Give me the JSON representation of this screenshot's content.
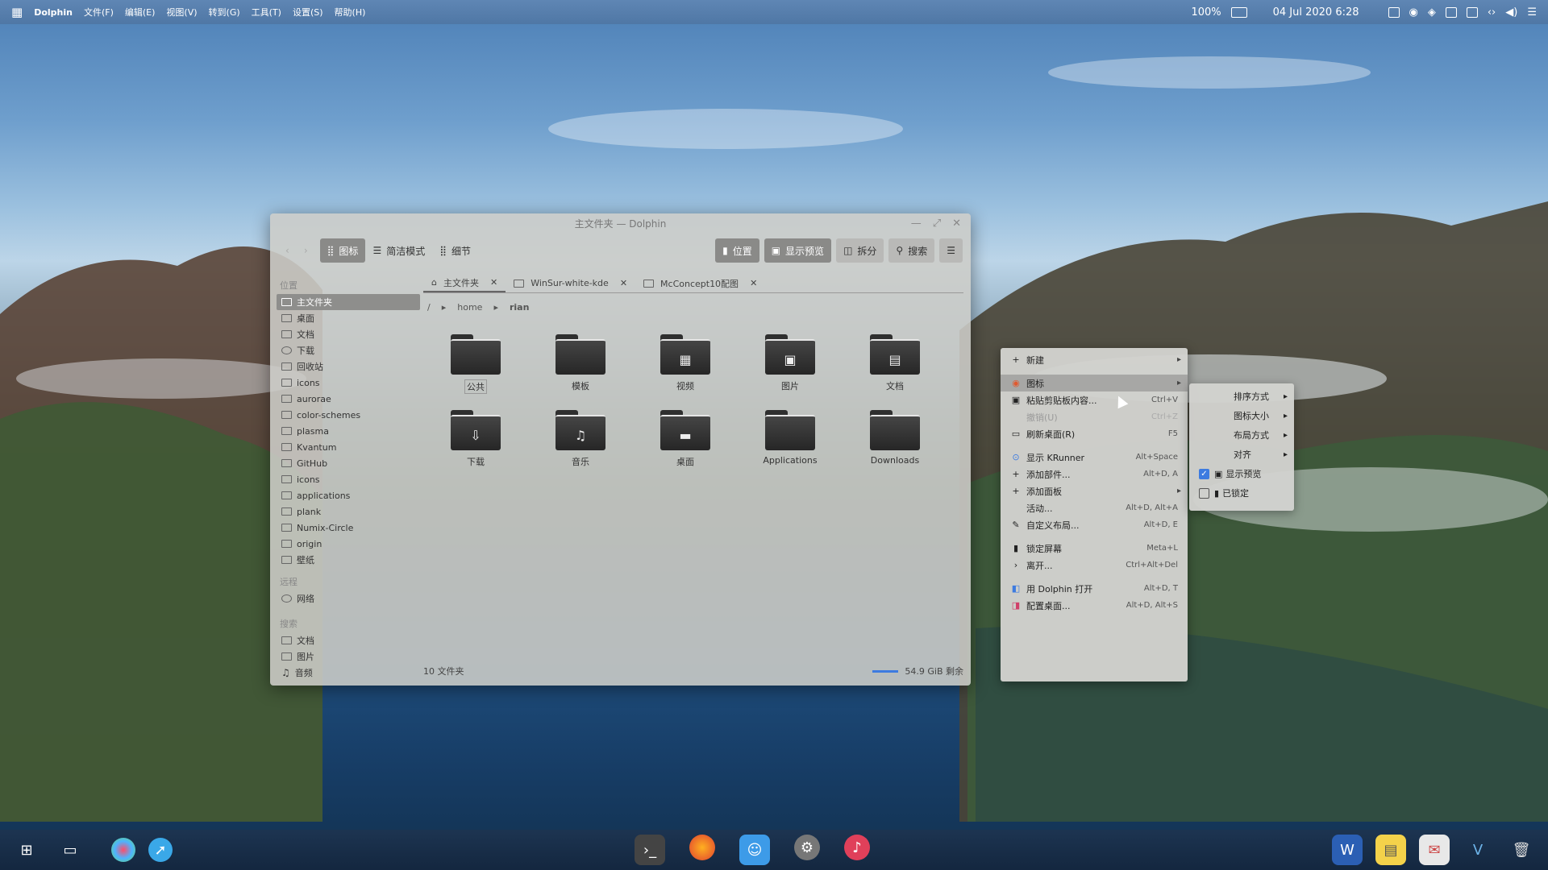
{
  "topbar": {
    "app": "Dolphin",
    "menus": [
      "文件(F)",
      "编辑(E)",
      "视图(V)",
      "转到(G)",
      "工具(T)",
      "设置(S)",
      "帮助(H)"
    ],
    "battery": "100%",
    "datetime": "04 Jul 2020 6:28"
  },
  "window": {
    "title": "主文件夹 — Dolphin",
    "toolbar": {
      "view_icons": "图标",
      "view_compact": "简洁模式",
      "view_details": "细节",
      "places": "位置",
      "preview": "显示预览",
      "split": "拆分",
      "search": "搜索"
    },
    "sidebar": {
      "places_header": "位置",
      "places": [
        "主文件夹",
        "桌面",
        "文档",
        "下载",
        "回收站",
        "icons",
        "aurorae",
        "color-schemes",
        "plasma",
        "Kvantum",
        "GitHub",
        "icons",
        "applications",
        "plank",
        "Numix-Circle",
        "origin",
        "壁纸"
      ],
      "remote_header": "远程",
      "remote": [
        "网络"
      ],
      "search_header": "搜索",
      "search": [
        "文档",
        "图片",
        "音频"
      ]
    },
    "tabs": [
      "主文件夹",
      "WinSur-white-kde",
      "McConcept10配图"
    ],
    "breadcrumb": [
      "/",
      "home",
      "rian"
    ],
    "files": [
      {
        "name": "公共",
        "glyph": ""
      },
      {
        "name": "模板",
        "glyph": ""
      },
      {
        "name": "视频",
        "glyph": "▦"
      },
      {
        "name": "图片",
        "glyph": "▣"
      },
      {
        "name": "文档",
        "glyph": "▤"
      },
      {
        "name": "下载",
        "glyph": "⇩"
      },
      {
        "name": "音乐",
        "glyph": "♫"
      },
      {
        "name": "桌面",
        "glyph": "▬"
      },
      {
        "name": "Applications",
        "glyph": ""
      },
      {
        "name": "Downloads",
        "glyph": ""
      }
    ],
    "status": {
      "count": "10 文件夹",
      "free": "54.9 GiB 剩余"
    }
  },
  "context_menu": {
    "items": [
      {
        "label": "新建",
        "shortcut": "",
        "arrow": "▸",
        "icon": "+",
        "state": ""
      },
      {
        "label": "图标",
        "shortcut": "",
        "arrow": "▸",
        "icon": "◉",
        "state": "hl"
      },
      {
        "label": "粘贴剪贴板内容...",
        "shortcut": "Ctrl+V",
        "arrow": "",
        "icon": "▣",
        "state": ""
      },
      {
        "label": "撤销(U)",
        "shortcut": "Ctrl+Z",
        "arrow": "",
        "icon": "",
        "state": "dis"
      },
      {
        "label": "刷新桌面(R)",
        "shortcut": "F5",
        "arrow": "",
        "icon": "▭",
        "state": ""
      },
      {
        "label": "显示 KRunner",
        "shortcut": "Alt+Space",
        "arrow": "",
        "icon": "⊙",
        "state": ""
      },
      {
        "label": "添加部件...",
        "shortcut": "Alt+D, A",
        "arrow": "",
        "icon": "+",
        "state": ""
      },
      {
        "label": "添加面板",
        "shortcut": "",
        "arrow": "▸",
        "icon": "+",
        "state": ""
      },
      {
        "label": "活动...",
        "shortcut": "Alt+D, Alt+A",
        "arrow": "",
        "icon": "",
        "state": ""
      },
      {
        "label": "自定义布局...",
        "shortcut": "Alt+D, E",
        "arrow": "",
        "icon": "✎",
        "state": ""
      },
      {
        "label": "锁定屏幕",
        "shortcut": "Meta+L",
        "arrow": "",
        "icon": "▮",
        "state": ""
      },
      {
        "label": "离开...",
        "shortcut": "Ctrl+Alt+Del",
        "arrow": "",
        "icon": "›",
        "state": ""
      },
      {
        "label": "用 Dolphin 打开",
        "shortcut": "Alt+D, T",
        "arrow": "",
        "icon": "◧",
        "state": ""
      },
      {
        "label": "配置桌面...",
        "shortcut": "Alt+D, Alt+S",
        "arrow": "",
        "icon": "◨",
        "state": ""
      }
    ],
    "submenu": {
      "sort": "排序方式",
      "icon_size": "图标大小",
      "layout": "布局方式",
      "align": "对齐",
      "show_preview": "显示预览",
      "locked": "已锁定"
    }
  },
  "colors": {
    "accent": "#3d7be0",
    "topbar": "#4f77a5"
  }
}
